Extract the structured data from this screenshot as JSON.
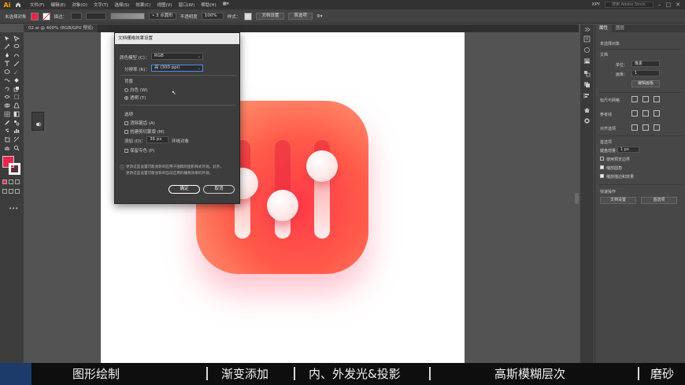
{
  "app": {
    "logo": "Ai"
  },
  "menubar": {
    "items": [
      "文件(F)",
      "编辑(E)",
      "对象(O)",
      "文字(T)",
      "选择(S)",
      "效果(C)",
      "视图(V)",
      "窗口(W)",
      "帮助(H)",
      "▦▾"
    ],
    "workspace": "XPY",
    "search_placeholder": "搜索 Adobe Stock"
  },
  "controlbar": {
    "selection": "未选择对象",
    "stroke_label": "描边：",
    "stroke_value": "",
    "brush": "• 3 点圆形",
    "opacity_label": "不透明度",
    "opacity_value": "100%",
    "style_label": "样式：",
    "doc_setup": "文档设置",
    "prefs": "首选项"
  },
  "document": {
    "tab": "02.ai @ 400% (RGB/GPU 预览)"
  },
  "dialog": {
    "title": "文档栅格效果设置",
    "color_model_label": "颜色模型 (C)：",
    "color_model_value": "RGB",
    "resolution_label": "分辨率 (R)：",
    "resolution_value": "高 (300 ppi)",
    "background_heading": "背景",
    "bg_white": "白色 (W)",
    "bg_transparent": "透明 (T)",
    "options_heading": "选项",
    "antialias": "消除锯齿 (A)",
    "clipping_mask": "创建剪切蒙版 (M)",
    "add_label": "添加 (D)：",
    "add_value": "36 px",
    "add_suffix": "环绕对象",
    "preserve_spot": "保留专色 (P)",
    "info_line1": "更改这些设置可能会影响应用于图稿的图形样式外观。此外，",
    "info_line2": "更改这些设置可能会影响当前应用的栅格效果的外观。",
    "ok": "确定",
    "cancel": "取消"
  },
  "panel": {
    "tabs": [
      "属性",
      "图层"
    ],
    "no_selection": "未选择对象",
    "doc_heading": "文档",
    "units_label": "单位：",
    "units_value": "像素",
    "artboard_label": "画板：",
    "artboard_value": "1",
    "edit_artboard": "编辑画板",
    "rulers_grids": "标尺与网格",
    "guides": "参考线",
    "align_options": "对齐选项",
    "prefs_heading": "首选项",
    "key_increment_label": "键盘增量：",
    "key_increment_value": "1 px",
    "preview_bounds": "使用预览边界",
    "scale_corners": "缩放圆角",
    "scale_strokes": "缩放描边和效果",
    "quick_actions": "快速操作",
    "doc_setup_btn": "文档设置",
    "prefs_btn": "首选项"
  },
  "subtitle_bar": {
    "segments": [
      "图形绘制",
      "渐变添加",
      "内、外发光&投影",
      "高斯模糊层次",
      "磨砂"
    ]
  },
  "colors": {
    "fill_swatch": "#e8264b",
    "accent": "#4b8cf0",
    "icon_red": "#ff3a48",
    "icon_light": "#ffb49a"
  }
}
